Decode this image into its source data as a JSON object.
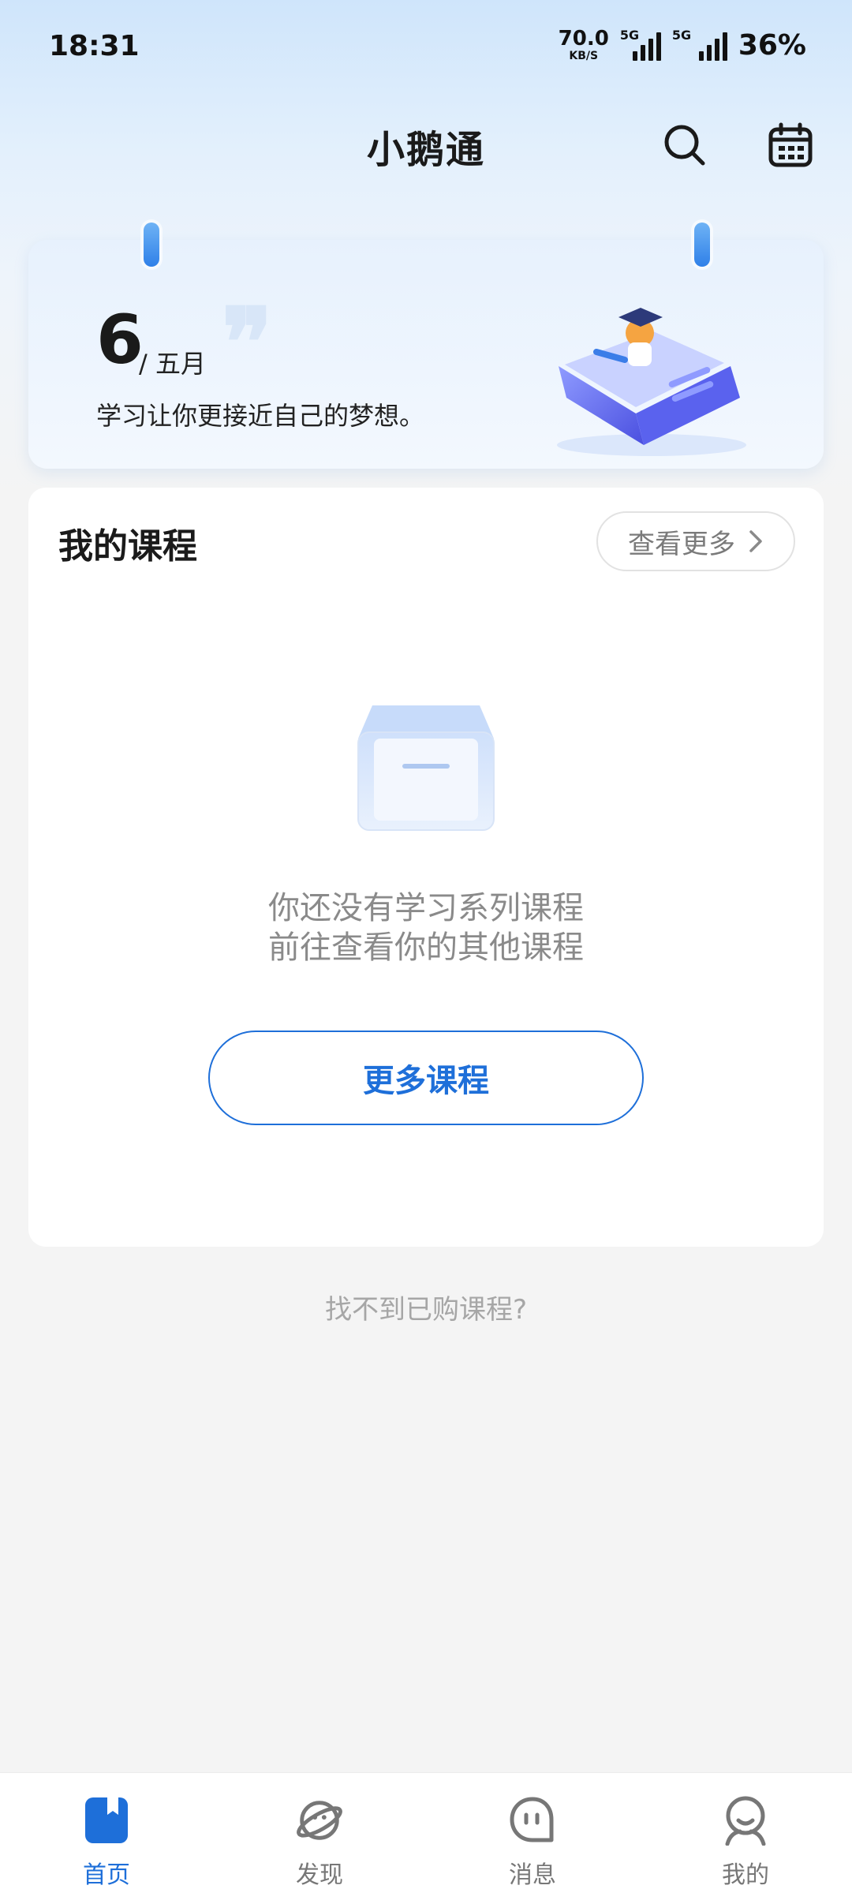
{
  "status_bar": {
    "time": "18:31",
    "net_speed_value": "70.0",
    "net_speed_unit": "KB/S",
    "sim1_tag": "5G",
    "sim2_tag": "5G",
    "battery": "36%"
  },
  "header": {
    "title": "小鹅通",
    "search_icon": "search-icon",
    "calendar_icon": "calendar-icon"
  },
  "banner": {
    "day": "6",
    "month": "/ 五月",
    "motto": "学习让你更接近自己的梦想。"
  },
  "courses": {
    "title": "我的课程",
    "view_more_label": "查看更多",
    "empty_line1": "你还没有学习系列课程",
    "empty_line2": "前往查看你的其他课程",
    "more_courses_button": "更多课程"
  },
  "find_courses_link": "找不到已购课程?",
  "bottom_nav": {
    "items": [
      {
        "label": "首页",
        "icon": "home-book-icon",
        "active": true
      },
      {
        "label": "发现",
        "icon": "planet-icon",
        "active": false
      },
      {
        "label": "消息",
        "icon": "message-bubble-icon",
        "active": false
      },
      {
        "label": "我的",
        "icon": "profile-avatar-icon",
        "active": false
      }
    ]
  },
  "colors": {
    "accent": "#1e6fd9",
    "background": "#f4f4f4"
  }
}
